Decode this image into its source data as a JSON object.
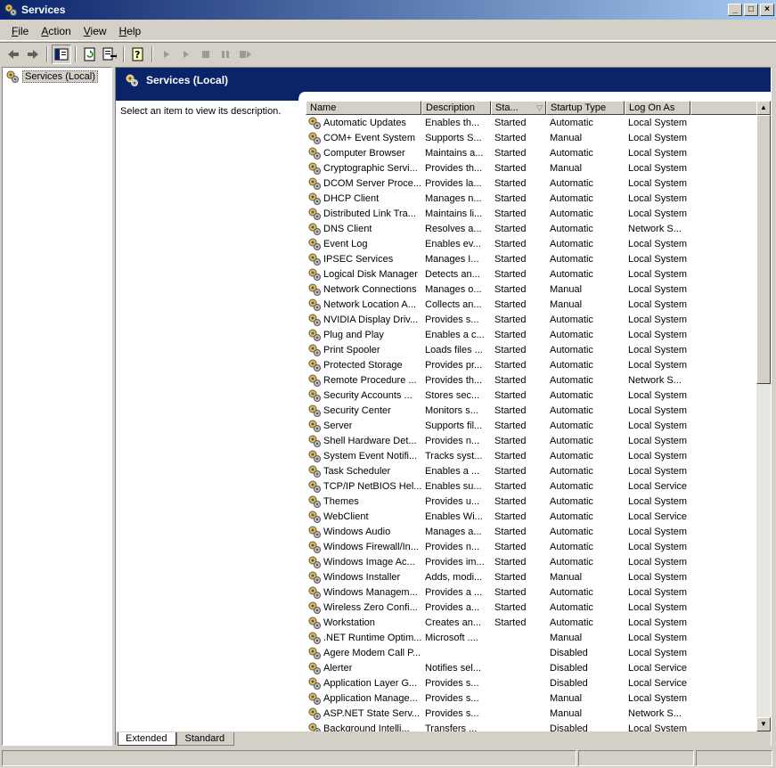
{
  "window": {
    "title": "Services",
    "buttons": {
      "minimize": "_",
      "maximize": "□",
      "close": "×"
    }
  },
  "menu": [
    {
      "label": "File",
      "u": "F",
      "rest": "ile"
    },
    {
      "label": "Action",
      "u": "A",
      "rest": "ction"
    },
    {
      "label": "View",
      "u": "V",
      "rest": "iew"
    },
    {
      "label": "Help",
      "u": "H",
      "rest": "elp"
    }
  ],
  "toolbar": {
    "icons": [
      "back-icon",
      "forward-icon",
      "show-hide-tree-icon",
      "refresh-icon",
      "export-list-icon",
      "help-icon",
      "start-service-icon",
      "start-service-alt-icon",
      "stop-service-icon",
      "pause-service-icon",
      "restart-service-icon"
    ]
  },
  "tree": {
    "root_label": "Services (Local)"
  },
  "detail": {
    "header": "Services (Local)",
    "description_prompt": "Select an item to view its description."
  },
  "columns": [
    {
      "label": "Name"
    },
    {
      "label": "Description"
    },
    {
      "label": "Sta...",
      "sort": "▽"
    },
    {
      "label": "Startup Type"
    },
    {
      "label": "Log On As"
    }
  ],
  "services": [
    [
      "Automatic Updates",
      "Enables th...",
      "Started",
      "Automatic",
      "Local System"
    ],
    [
      "COM+ Event System",
      "Supports S...",
      "Started",
      "Manual",
      "Local System"
    ],
    [
      "Computer Browser",
      "Maintains a...",
      "Started",
      "Automatic",
      "Local System"
    ],
    [
      "Cryptographic Servi...",
      "Provides th...",
      "Started",
      "Manual",
      "Local System"
    ],
    [
      "DCOM Server Proce...",
      "Provides la...",
      "Started",
      "Automatic",
      "Local System"
    ],
    [
      "DHCP Client",
      "Manages n...",
      "Started",
      "Automatic",
      "Local System"
    ],
    [
      "Distributed Link Tra...",
      "Maintains li...",
      "Started",
      "Automatic",
      "Local System"
    ],
    [
      "DNS Client",
      "Resolves a...",
      "Started",
      "Automatic",
      "Network S..."
    ],
    [
      "Event Log",
      "Enables ev...",
      "Started",
      "Automatic",
      "Local System"
    ],
    [
      "IPSEC Services",
      "Manages I...",
      "Started",
      "Automatic",
      "Local System"
    ],
    [
      "Logical Disk Manager",
      "Detects an...",
      "Started",
      "Automatic",
      "Local System"
    ],
    [
      "Network Connections",
      "Manages o...",
      "Started",
      "Manual",
      "Local System"
    ],
    [
      "Network Location A...",
      "Collects an...",
      "Started",
      "Manual",
      "Local System"
    ],
    [
      "NVIDIA Display Driv...",
      "Provides s...",
      "Started",
      "Automatic",
      "Local System"
    ],
    [
      "Plug and Play",
      "Enables a c...",
      "Started",
      "Automatic",
      "Local System"
    ],
    [
      "Print Spooler",
      "Loads files ...",
      "Started",
      "Automatic",
      "Local System"
    ],
    [
      "Protected Storage",
      "Provides pr...",
      "Started",
      "Automatic",
      "Local System"
    ],
    [
      "Remote Procedure ...",
      "Provides th...",
      "Started",
      "Automatic",
      "Network S..."
    ],
    [
      "Security Accounts ...",
      "Stores sec...",
      "Started",
      "Automatic",
      "Local System"
    ],
    [
      "Security Center",
      "Monitors s...",
      "Started",
      "Automatic",
      "Local System"
    ],
    [
      "Server",
      "Supports fil...",
      "Started",
      "Automatic",
      "Local System"
    ],
    [
      "Shell Hardware Det...",
      "Provides n...",
      "Started",
      "Automatic",
      "Local System"
    ],
    [
      "System Event Notifi...",
      "Tracks syst...",
      "Started",
      "Automatic",
      "Local System"
    ],
    [
      "Task Scheduler",
      "Enables a ...",
      "Started",
      "Automatic",
      "Local System"
    ],
    [
      "TCP/IP NetBIOS Hel...",
      "Enables su...",
      "Started",
      "Automatic",
      "Local Service"
    ],
    [
      "Themes",
      "Provides u...",
      "Started",
      "Automatic",
      "Local System"
    ],
    [
      "WebClient",
      "Enables Wi...",
      "Started",
      "Automatic",
      "Local Service"
    ],
    [
      "Windows Audio",
      "Manages a...",
      "Started",
      "Automatic",
      "Local System"
    ],
    [
      "Windows Firewall/In...",
      "Provides n...",
      "Started",
      "Automatic",
      "Local System"
    ],
    [
      "Windows Image Ac...",
      "Provides im...",
      "Started",
      "Automatic",
      "Local System"
    ],
    [
      "Windows Installer",
      "Adds, modi...",
      "Started",
      "Manual",
      "Local System"
    ],
    [
      "Windows Managem...",
      "Provides a ...",
      "Started",
      "Automatic",
      "Local System"
    ],
    [
      "Wireless Zero Confi...",
      "Provides a...",
      "Started",
      "Automatic",
      "Local System"
    ],
    [
      "Workstation",
      "Creates an...",
      "Started",
      "Automatic",
      "Local System"
    ],
    [
      ".NET Runtime Optim...",
      "Microsoft ....",
      "",
      "Manual",
      "Local System"
    ],
    [
      "Agere Modem Call P...",
      "",
      "",
      "Disabled",
      "Local System"
    ],
    [
      "Alerter",
      "Notifies sel...",
      "",
      "Disabled",
      "Local Service"
    ],
    [
      "Application Layer G...",
      "Provides s...",
      "",
      "Disabled",
      "Local Service"
    ],
    [
      "Application Manage...",
      "Provides s...",
      "",
      "Manual",
      "Local System"
    ],
    [
      "ASP.NET State Serv...",
      "Provides s...",
      "",
      "Manual",
      "Network S..."
    ],
    [
      "Background Intelli...",
      "Transfers ...",
      "",
      "Disabled",
      "Local System"
    ]
  ],
  "tabs": [
    "Extended",
    "Standard"
  ],
  "colors": {
    "title_start": "#0a246a",
    "title_end": "#a6caf0",
    "band": "#0a246a",
    "face": "#d4d0c8"
  }
}
